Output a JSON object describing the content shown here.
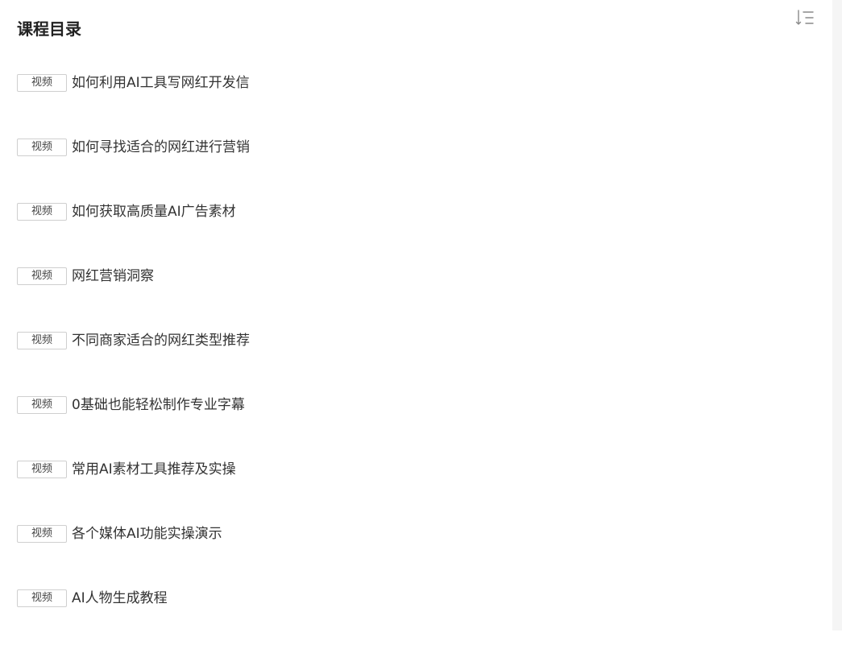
{
  "header": {
    "title": "课程目录",
    "sort_icon": "sort-list-icon"
  },
  "lessons": [
    {
      "badge": "视频",
      "title": "如何利用AI工具写网红开发信"
    },
    {
      "badge": "视频",
      "title": "如何寻找适合的网红进行营销"
    },
    {
      "badge": "视频",
      "title": "如何获取高质量AI广告素材"
    },
    {
      "badge": "视频",
      "title": "网红营销洞察"
    },
    {
      "badge": "视频",
      "title": "不同商家适合的网红类型推荐"
    },
    {
      "badge": "视频",
      "title": "0基础也能轻松制作专业字幕"
    },
    {
      "badge": "视频",
      "title": "常用AI素材工具推荐及实操"
    },
    {
      "badge": "视频",
      "title": "各个媒体AI功能实操演示"
    },
    {
      "badge": "视频",
      "title": "AI人物生成教程"
    }
  ],
  "colors": {
    "text": "#333333",
    "badge_border": "#cfcfcf",
    "icon": "#8a8a8a",
    "gutter": "#f5f5f5"
  }
}
